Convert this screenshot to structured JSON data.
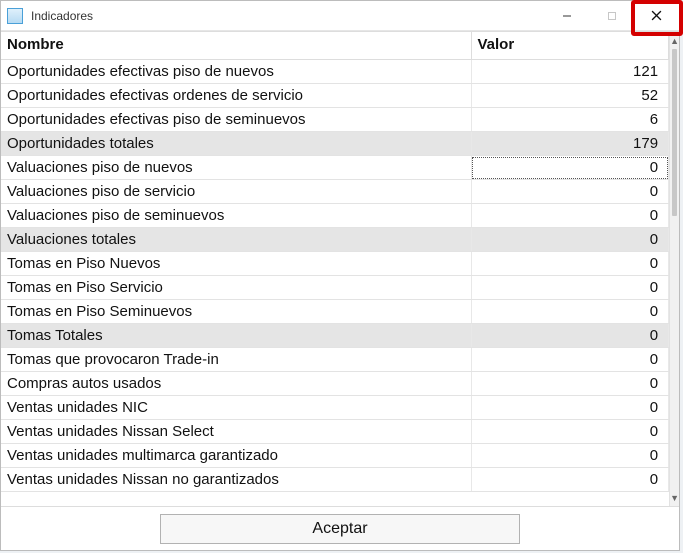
{
  "window": {
    "title": "Indicadores"
  },
  "columns": {
    "name": "Nombre",
    "value": "Valor"
  },
  "rows": [
    {
      "name": "Oportunidades efectivas piso de nuevos",
      "value": "121",
      "total": false
    },
    {
      "name": "Oportunidades efectivas ordenes de servicio",
      "value": "52",
      "total": false
    },
    {
      "name": "Oportunidades efectivas piso de seminuevos",
      "value": "6",
      "total": false
    },
    {
      "name": "Oportunidades totales",
      "value": "179",
      "total": true
    },
    {
      "name": "Valuaciones piso de nuevos",
      "value": "0",
      "total": false,
      "focused": true
    },
    {
      "name": "Valuaciones piso de servicio",
      "value": "0",
      "total": false
    },
    {
      "name": "Valuaciones piso de seminuevos",
      "value": "0",
      "total": false
    },
    {
      "name": "Valuaciones totales",
      "value": "0",
      "total": true
    },
    {
      "name": "Tomas en Piso Nuevos",
      "value": "0",
      "total": false
    },
    {
      "name": "Tomas en Piso Servicio",
      "value": "0",
      "total": false
    },
    {
      "name": "Tomas en Piso Seminuevos",
      "value": "0",
      "total": false
    },
    {
      "name": "Tomas Totales",
      "value": "0",
      "total": true
    },
    {
      "name": "Tomas que provocaron Trade-in",
      "value": "0",
      "total": false
    },
    {
      "name": "Compras autos usados",
      "value": "0",
      "total": false
    },
    {
      "name": "Ventas unidades NIC",
      "value": "0",
      "total": false
    },
    {
      "name": "Ventas unidades Nissan Select",
      "value": "0",
      "total": false
    },
    {
      "name": "Ventas unidades multimarca garantizado",
      "value": "0",
      "total": false
    },
    {
      "name": "Ventas unidades Nissan no garantizados",
      "value": "0",
      "total": false
    }
  ],
  "footer": {
    "accept": "Aceptar"
  }
}
